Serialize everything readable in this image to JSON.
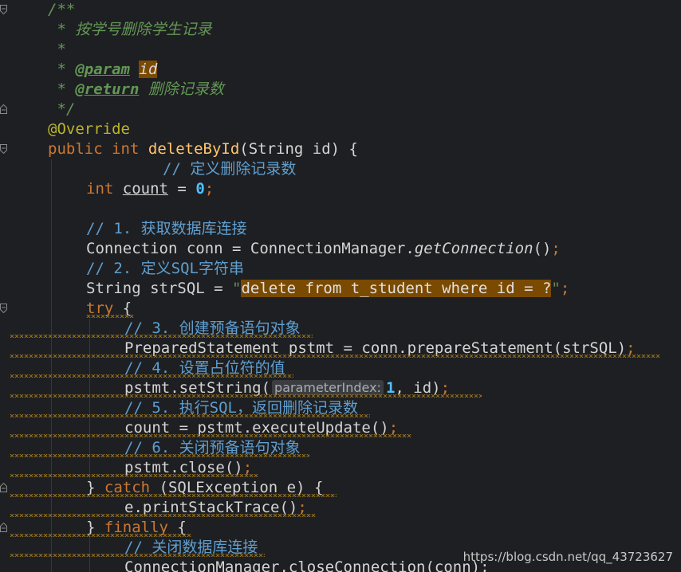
{
  "lines": {
    "l1": "/**",
    "l2": " * 按学号删除学生记录",
    "l3": " *",
    "l4_star": " * ",
    "l4_tag": "@param",
    "l4_name": "id",
    "l5_star": " * ",
    "l5_tag": "@return",
    "l5_desc": " 删除记录数",
    "l6": " */",
    "l7": "@Override",
    "l8_kw1": "public",
    "l8_kw2": "int",
    "l8_fn": "deleteById",
    "l8_rest": "(String id) {",
    "l9": "// 定义删除记录数",
    "l10_kw": "int",
    "l10_var": "count",
    "l10_eq": " = ",
    "l10_num": "0",
    "l11": "// 1. 获取数据库连接",
    "l12_a": "Connection conn = ConnectionManager.",
    "l12_m": "getConnection",
    "l12_b": "()",
    "l13": "// 2. 定义SQL字符串",
    "l14_a": "String strSQL = ",
    "l14_q": "\"",
    "l14_str": "delete from t_student where id = ?",
    "l15_kw": "try",
    "l15_b": " {",
    "l16": "// 3. 创建预备语句对象",
    "l17": "PreparedStatement pstmt = conn.prepareStatement(strSQL)",
    "l18": "// 4. 设置占位符的值",
    "l19_a": "pstmt.setString(",
    "l19_hint": "parameterIndex:",
    "l19_num": "1",
    "l19_b": ", id)",
    "l20": "// 5. 执行SQL，返回删除记录数",
    "l21": "count = pstmt.executeUpdate()",
    "l22": "// 6. 关闭预备语句对象",
    "l23": "pstmt.close()",
    "l24_a": "} ",
    "l24_kw": "catch",
    "l24_b": " (SQLException e) {",
    "l25": "e.printStackTrace()",
    "l26_a": "} ",
    "l26_kw": "finally",
    "l26_b": " {",
    "l27": "// 关闭数据库连接",
    "l28": "ConnectionManager.closeConnection(conn);"
  },
  "semicolon": ";",
  "watermark": "https://blog.csdn.net/qq_43723627"
}
